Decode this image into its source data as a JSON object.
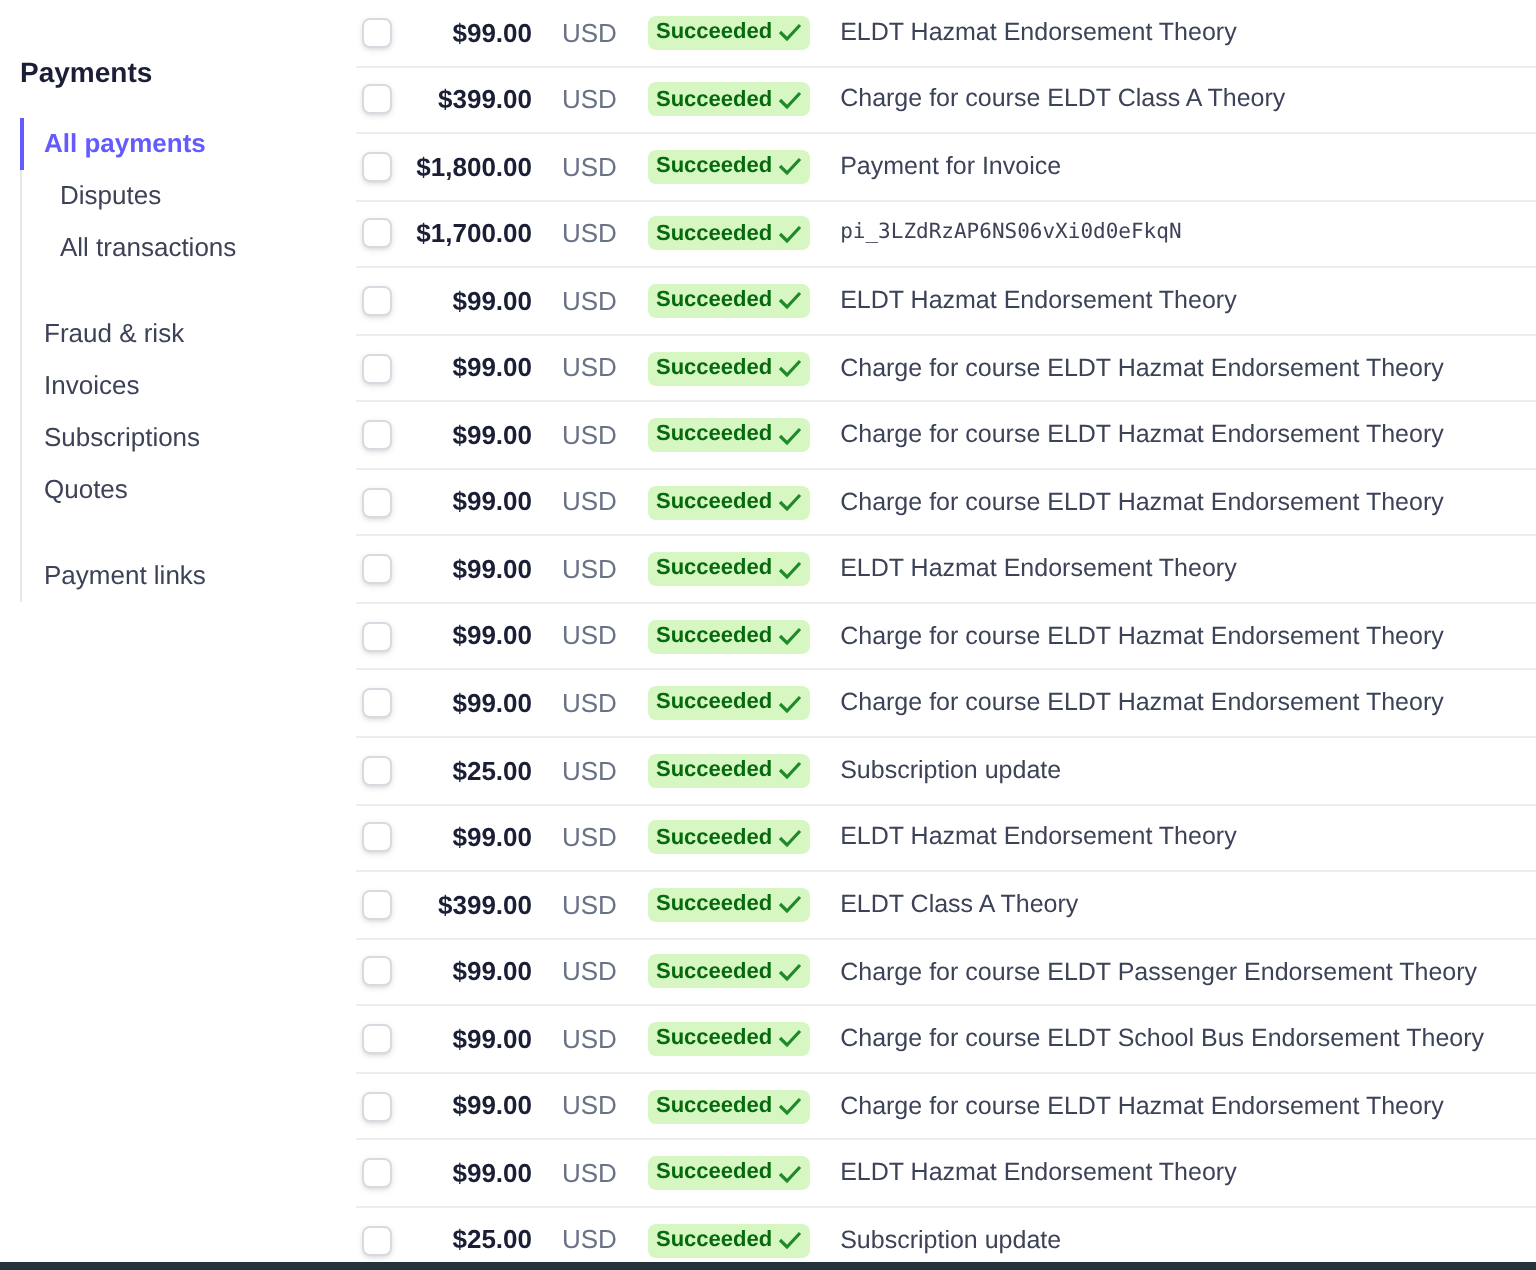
{
  "sidebar": {
    "title": "Payments",
    "groups": [
      {
        "items": [
          {
            "label": "All payments",
            "selected": true,
            "sub": false
          },
          {
            "label": "Disputes",
            "selected": false,
            "sub": true
          },
          {
            "label": "All transactions",
            "selected": false,
            "sub": true
          }
        ]
      },
      {
        "items": [
          {
            "label": "Fraud & risk",
            "selected": false,
            "sub": false
          },
          {
            "label": "Invoices",
            "selected": false,
            "sub": false
          },
          {
            "label": "Subscriptions",
            "selected": false,
            "sub": false
          },
          {
            "label": "Quotes",
            "selected": false,
            "sub": false
          }
        ]
      },
      {
        "items": [
          {
            "label": "Payment links",
            "selected": false,
            "sub": false
          }
        ]
      }
    ]
  },
  "payments": [
    {
      "checked": false,
      "amount": "$99.00",
      "currency": "USD",
      "status": "Succeeded",
      "description": "ELDT Hazmat Endorsement Theory",
      "kind": "text"
    },
    {
      "checked": false,
      "amount": "$399.00",
      "currency": "USD",
      "status": "Succeeded",
      "description": "Charge for course ELDT Class A Theory",
      "kind": "text"
    },
    {
      "checked": false,
      "amount": "$1,800.00",
      "currency": "USD",
      "status": "Succeeded",
      "description": "Payment for Invoice",
      "kind": "text"
    },
    {
      "checked": false,
      "amount": "$1,700.00",
      "currency": "USD",
      "status": "Succeeded",
      "description": "pi_3LZdRzAP6NS06vXi0d0eFkqN",
      "kind": "id"
    },
    {
      "checked": false,
      "amount": "$99.00",
      "currency": "USD",
      "status": "Succeeded",
      "description": "ELDT Hazmat Endorsement Theory",
      "kind": "text"
    },
    {
      "checked": false,
      "amount": "$99.00",
      "currency": "USD",
      "status": "Succeeded",
      "description": "Charge for course ELDT Hazmat Endorsement Theory",
      "kind": "text"
    },
    {
      "checked": false,
      "amount": "$99.00",
      "currency": "USD",
      "status": "Succeeded",
      "description": "Charge for course ELDT Hazmat Endorsement Theory",
      "kind": "text"
    },
    {
      "checked": false,
      "amount": "$99.00",
      "currency": "USD",
      "status": "Succeeded",
      "description": "Charge for course ELDT Hazmat Endorsement Theory",
      "kind": "text"
    },
    {
      "checked": false,
      "amount": "$99.00",
      "currency": "USD",
      "status": "Succeeded",
      "description": "ELDT Hazmat Endorsement Theory",
      "kind": "text"
    },
    {
      "checked": false,
      "amount": "$99.00",
      "currency": "USD",
      "status": "Succeeded",
      "description": "Charge for course ELDT Hazmat Endorsement Theory",
      "kind": "text"
    },
    {
      "checked": false,
      "amount": "$99.00",
      "currency": "USD",
      "status": "Succeeded",
      "description": "Charge for course ELDT Hazmat Endorsement Theory",
      "kind": "text"
    },
    {
      "checked": false,
      "amount": "$25.00",
      "currency": "USD",
      "status": "Succeeded",
      "description": "Subscription update",
      "kind": "text"
    },
    {
      "checked": false,
      "amount": "$99.00",
      "currency": "USD",
      "status": "Succeeded",
      "description": "ELDT Hazmat Endorsement Theory",
      "kind": "text"
    },
    {
      "checked": false,
      "amount": "$399.00",
      "currency": "USD",
      "status": "Succeeded",
      "description": "ELDT Class A Theory",
      "kind": "text"
    },
    {
      "checked": false,
      "amount": "$99.00",
      "currency": "USD",
      "status": "Succeeded",
      "description": "Charge for course ELDT Passenger Endorsement Theory",
      "kind": "text"
    },
    {
      "checked": false,
      "amount": "$99.00",
      "currency": "USD",
      "status": "Succeeded",
      "description": "Charge for course ELDT School Bus Endorsement Theory",
      "kind": "text"
    },
    {
      "checked": false,
      "amount": "$99.00",
      "currency": "USD",
      "status": "Succeeded",
      "description": "Charge for course ELDT Hazmat Endorsement Theory",
      "kind": "text"
    },
    {
      "checked": false,
      "amount": "$99.00",
      "currency": "USD",
      "status": "Succeeded",
      "description": "ELDT Hazmat Endorsement Theory",
      "kind": "text"
    },
    {
      "checked": false,
      "amount": "$25.00",
      "currency": "USD",
      "status": "Succeeded",
      "description": "Subscription update",
      "kind": "text"
    }
  ]
}
